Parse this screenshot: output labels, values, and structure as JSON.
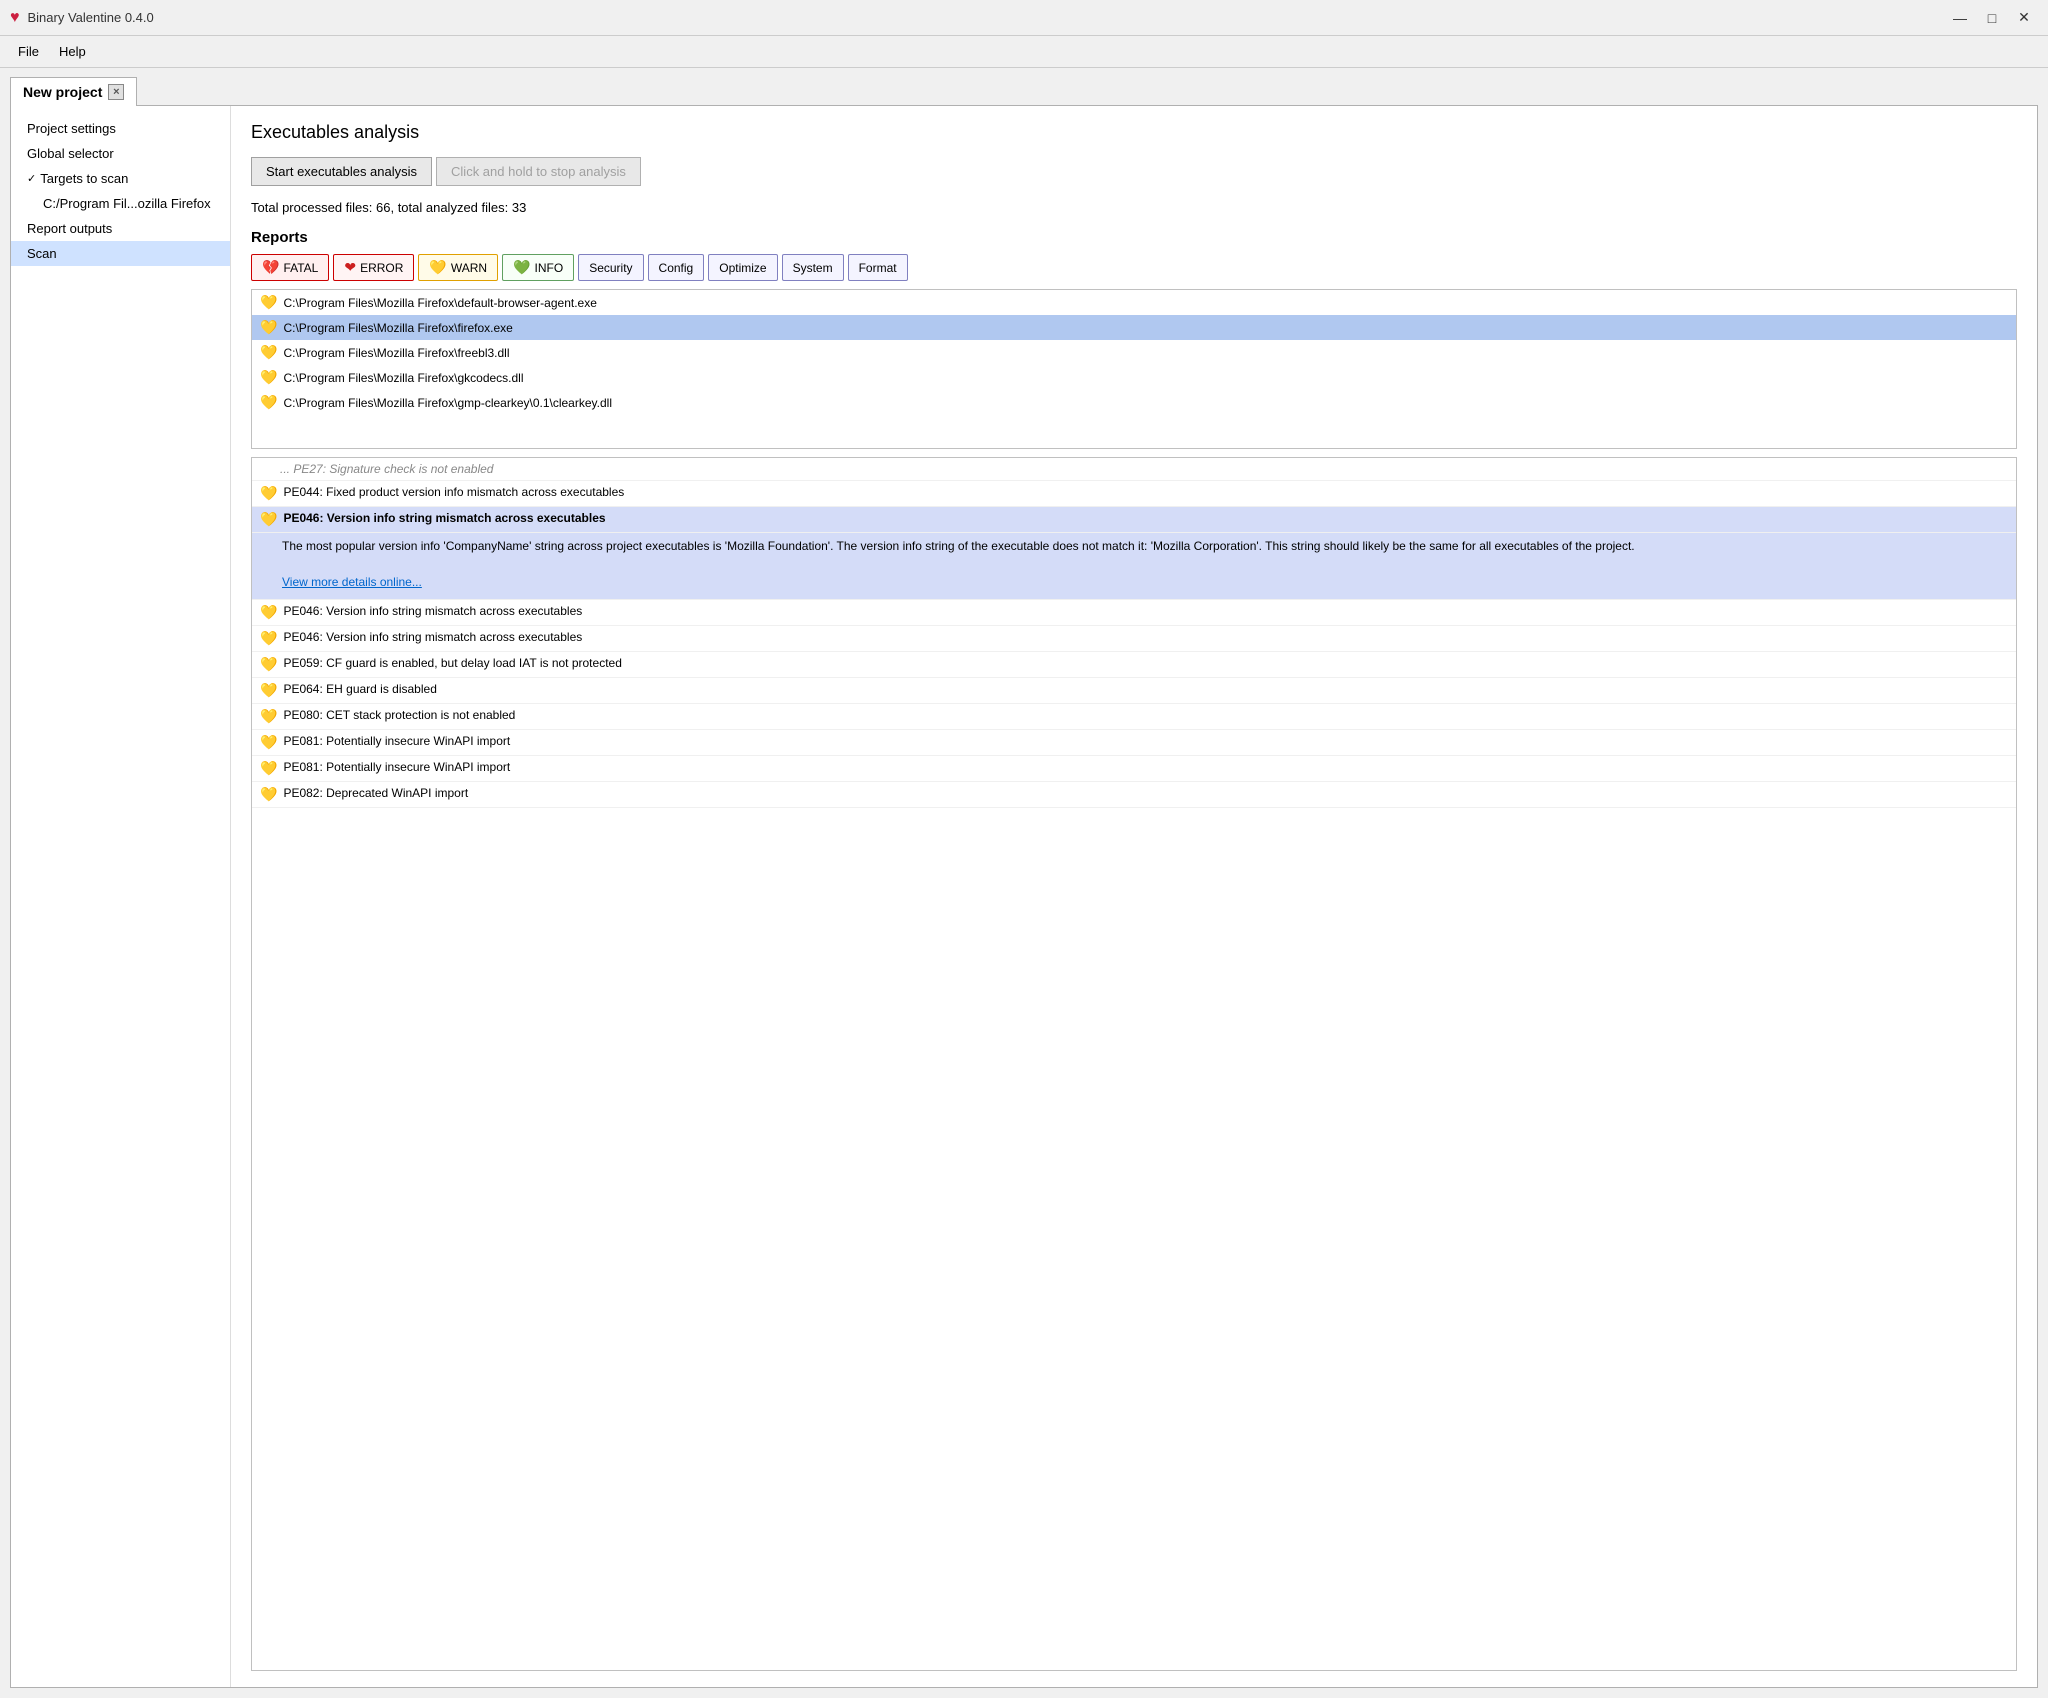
{
  "titlebar": {
    "logo": "♥",
    "title": "Binary Valentine 0.4.0",
    "minimize_label": "—",
    "maximize_label": "□",
    "close_label": "✕"
  },
  "menubar": {
    "items": [
      {
        "id": "file",
        "label": "File"
      },
      {
        "id": "help",
        "label": "Help"
      }
    ]
  },
  "tab": {
    "label": "New project",
    "close_label": "×"
  },
  "sidebar": {
    "items": [
      {
        "id": "project-settings",
        "label": "Project settings",
        "indented": false,
        "has_chevron": false,
        "active": false
      },
      {
        "id": "global-selector",
        "label": "Global selector",
        "indented": false,
        "has_chevron": false,
        "active": false
      },
      {
        "id": "targets-to-scan",
        "label": "Targets to scan",
        "indented": false,
        "has_chevron": true,
        "active": false
      },
      {
        "id": "target-path",
        "label": "C:/Program Fil...ozilla Firefox",
        "indented": true,
        "has_chevron": false,
        "active": false
      },
      {
        "id": "report-outputs",
        "label": "Report outputs",
        "indented": false,
        "has_chevron": false,
        "active": false
      },
      {
        "id": "scan",
        "label": "Scan",
        "indented": false,
        "has_chevron": false,
        "active": true
      }
    ]
  },
  "content": {
    "title": "Executables analysis",
    "start_button": "Start executables analysis",
    "stop_button": "Click and hold to stop analysis",
    "stats": "Total processed files: 66, total analyzed files: 33",
    "reports_heading": "Reports",
    "filter_buttons": [
      {
        "id": "fatal",
        "label": "FATAL",
        "type": "fatal"
      },
      {
        "id": "error",
        "label": "ERROR",
        "type": "error"
      },
      {
        "id": "warn",
        "label": "WARN",
        "type": "warn"
      },
      {
        "id": "info",
        "label": "INFO",
        "type": "info"
      }
    ],
    "category_buttons": [
      {
        "id": "security",
        "label": "Security"
      },
      {
        "id": "config",
        "label": "Config"
      },
      {
        "id": "optimize",
        "label": "Optimize"
      },
      {
        "id": "system",
        "label": "System"
      },
      {
        "id": "format",
        "label": "Format"
      }
    ],
    "files": [
      {
        "id": "f1",
        "name": "C:\\Program Files\\Mozilla Firefox\\default-browser-agent.exe",
        "selected": false
      },
      {
        "id": "f2",
        "name": "C:\\Program Files\\Mozilla Firefox\\firefox.exe",
        "selected": true
      },
      {
        "id": "f3",
        "name": "C:\\Program Files\\Mozilla Firefox\\freebl3.dll",
        "selected": false
      },
      {
        "id": "f4",
        "name": "C:\\Program Files\\Mozilla Firefox\\gkcodecs.dll",
        "selected": false
      },
      {
        "id": "f5",
        "name": "C:\\Program Files\\Mozilla Firefox\\gmp-clearkey\\0.1\\clearkey.dll",
        "selected": false
      }
    ],
    "reports": [
      {
        "id": "r0",
        "code": "",
        "text": "PE27: Signature check is not enabled",
        "bold": false,
        "selected": false,
        "icon_type": "warn",
        "truncated": true
      },
      {
        "id": "r1",
        "code": "PE044:",
        "text": "PE044: Fixed product version info mismatch across executables",
        "bold": false,
        "selected": false,
        "icon_type": "warn"
      },
      {
        "id": "r2",
        "code": "PE046:",
        "text": "PE046: Version info string mismatch across executables",
        "bold": true,
        "selected": true,
        "icon_type": "warn"
      },
      {
        "id": "r3",
        "code": "PE046:",
        "text": "PE046: Version info string mismatch across executables",
        "bold": false,
        "selected": false,
        "icon_type": "warn"
      },
      {
        "id": "r4",
        "code": "PE046:",
        "text": "PE046: Version info string mismatch across executables",
        "bold": false,
        "selected": false,
        "icon_type": "warn"
      },
      {
        "id": "r5",
        "code": "PE059:",
        "text": "PE059: CF guard is enabled, but delay load IAT is not protected",
        "bold": false,
        "selected": false,
        "icon_type": "warn"
      },
      {
        "id": "r6",
        "code": "PE064:",
        "text": "PE064: EH guard is disabled",
        "bold": false,
        "selected": false,
        "icon_type": "warn"
      },
      {
        "id": "r7",
        "code": "PE080:",
        "text": "PE080: CET stack protection is not enabled",
        "bold": false,
        "selected": false,
        "icon_type": "warn"
      },
      {
        "id": "r8",
        "code": "PE081:",
        "text": "PE081: Potentially insecure WinAPI import",
        "bold": false,
        "selected": false,
        "icon_type": "warn"
      },
      {
        "id": "r9",
        "code": "PE081:",
        "text": "PE081: Potentially insecure WinAPI import",
        "bold": false,
        "selected": false,
        "icon_type": "warn"
      },
      {
        "id": "r10",
        "code": "PE082:",
        "text": "PE082: Deprecated WinAPI import",
        "bold": false,
        "selected": false,
        "icon_type": "warn"
      }
    ],
    "expanded_report": {
      "title": "PE046: Version info string mismatch across executables",
      "detail": "The most popular version info 'CompanyName' string across project executables is 'Mozilla Foundation'. The version info string of the executable does not match it: 'Mozilla Corporation'. This string should likely be the same for all executables of the project.",
      "link_text": "View more details online..."
    }
  }
}
